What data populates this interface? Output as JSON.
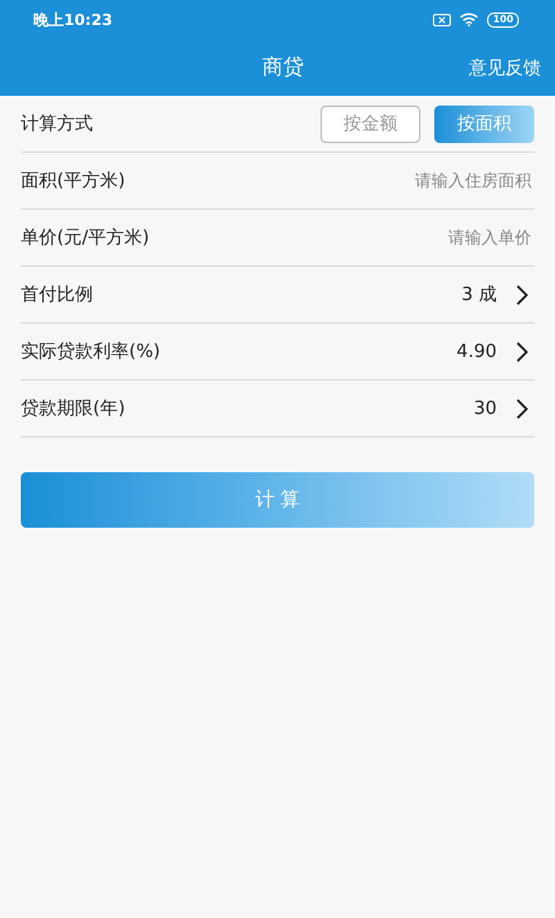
{
  "status_bar": {
    "time": "晚上10:23",
    "battery": "100"
  },
  "header": {
    "title": "商贷",
    "action": "意见反馈"
  },
  "rows": [
    {
      "kind": "toggle",
      "label": "计算方式",
      "options": [
        {
          "label": "按金额",
          "selected": false
        },
        {
          "label": "按面积",
          "selected": true
        }
      ]
    },
    {
      "kind": "input",
      "label": "面积(平方米)",
      "placeholder": "请输入住房面积"
    },
    {
      "kind": "input",
      "label": "单价(元/平方米)",
      "placeholder": "请输入单价"
    },
    {
      "kind": "select",
      "label": "首付比例",
      "value": "3 成"
    },
    {
      "kind": "select",
      "label": "实际贷款利率(%)",
      "value": "4.90"
    },
    {
      "kind": "select",
      "label": "贷款期限(年)",
      "value": "30"
    }
  ],
  "calculate_button": "计 算"
}
